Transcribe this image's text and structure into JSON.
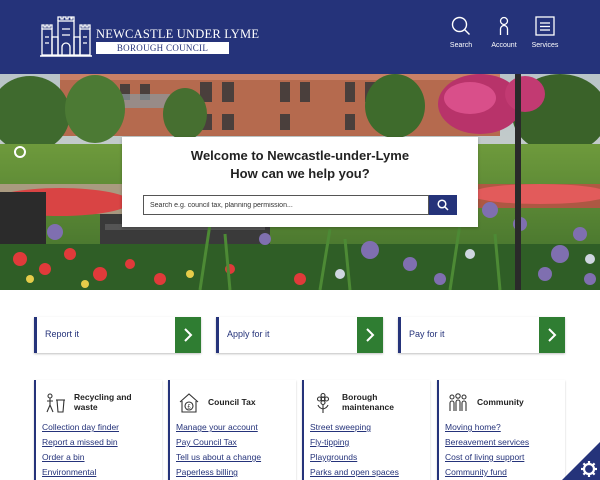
{
  "header": {
    "logo_title": "NEWCASTLE UNDER LYME",
    "logo_subtitle": "BOROUGH COUNCIL",
    "nav": {
      "search_label": "Search",
      "account_label": "Account",
      "services_label": "Services"
    }
  },
  "hero": {
    "welcome_line1": "Welcome to Newcastle-under-Lyme",
    "welcome_line2": "How can we help you?",
    "search_placeholder": "Search e.g. council tax, planning permission..."
  },
  "actions": [
    {
      "label": "Report it"
    },
    {
      "label": "Apply for it"
    },
    {
      "label": "Pay for it"
    }
  ],
  "categories": [
    {
      "title_line1": "Recycling and",
      "title_line2": "waste",
      "icon": "recycling-bin-icon",
      "links": [
        "Collection day finder",
        "Report a missed bin",
        "Order a bin",
        "Environmental"
      ]
    },
    {
      "title_line1": "Council Tax",
      "title_line2": "",
      "icon": "pound-house-icon",
      "links": [
        "Manage your account",
        "Pay Council Tax",
        "Tell us about a change",
        "Paperless billing"
      ]
    },
    {
      "title_line1": "Borough",
      "title_line2": "maintenance",
      "icon": "flower-icon",
      "links": [
        "Street sweeping",
        "Fly-tipping",
        "Playgrounds",
        "Parks and open spaces"
      ]
    },
    {
      "title_line1": "Community",
      "title_line2": "",
      "icon": "people-icon",
      "links": [
        "Moving home?",
        "Bereavement services",
        "Cost of living support",
        "Community fund"
      ]
    }
  ],
  "colors": {
    "brand_navy": "#25337a",
    "action_green": "#2f7d32"
  }
}
